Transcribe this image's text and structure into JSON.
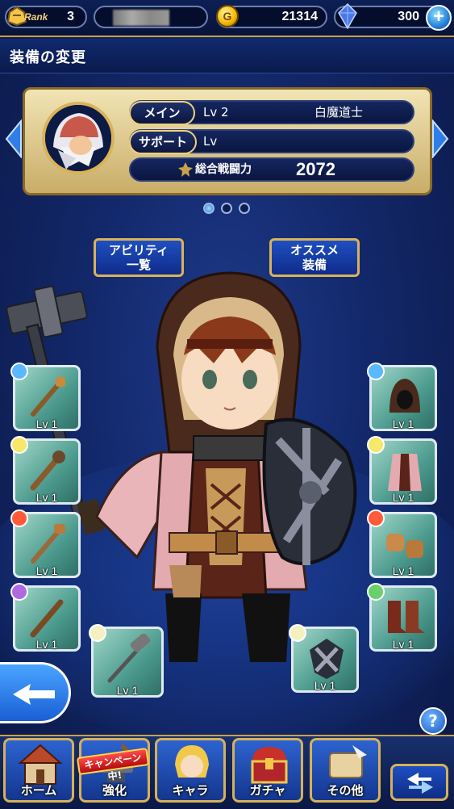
{
  "header": {
    "rank_label": "Rank",
    "rank_value": "3",
    "gold": "21314",
    "gems": "300",
    "plus": "+"
  },
  "title": "装備の変更",
  "character_panel": {
    "main_label": "メイン",
    "main_level": "Lv 2",
    "main_job": "白魔道士",
    "support_label": "サポート",
    "support_level": "Lv",
    "power_label": "総合戦闘力",
    "power_value": "2072",
    "page_dots": 3,
    "active_page": 1
  },
  "buttons": {
    "ability_line1": "アビリティ",
    "ability_line2": "一覧",
    "recommend_line1": "オススメ",
    "recommend_line2": "装備"
  },
  "slots": {
    "left": [
      {
        "level": "Lv 1",
        "gem_color": "#5ab8ff"
      },
      {
        "level": "Lv 1",
        "gem_color": "#f5e86a"
      },
      {
        "level": "Lv 1",
        "gem_color": "#ff5a3a"
      },
      {
        "level": "Lv 1",
        "gem_color": "#b06ae0"
      }
    ],
    "right": [
      {
        "level": "Lv 1",
        "gem_color": "#5ab8ff"
      },
      {
        "level": "Lv 1",
        "gem_color": "#f5e86a"
      },
      {
        "level": "Lv 1",
        "gem_color": "#ff5a3a"
      },
      {
        "level": "Lv 1",
        "gem_color": "#6ad06a"
      }
    ],
    "bottom_left": {
      "level": "Lv 1",
      "gem_color": "#f5f0c0"
    },
    "bottom_right": {
      "level": "Lv 1",
      "gem_color": "#f5f0c0"
    }
  },
  "help": "?",
  "nav": {
    "home": "ホーム",
    "enhance": "強化",
    "campaign": "キャンペーン中!",
    "chara": "キャラ",
    "gacha": "ガチャ",
    "other": "その他"
  },
  "colors": {
    "accent_gold": "#d9b35a",
    "panel_bg": "#0a1640",
    "slot_green": "#4c9a8e"
  }
}
